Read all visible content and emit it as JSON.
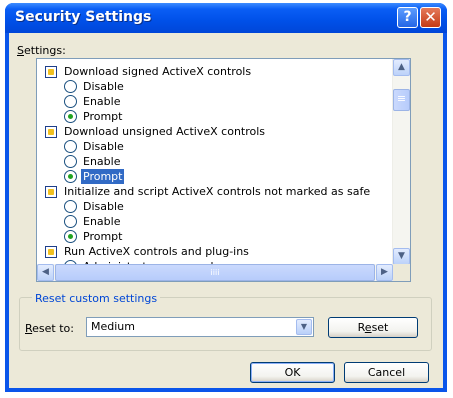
{
  "window": {
    "title": "Security Settings",
    "help_glyph": "?",
    "close_glyph": "✕"
  },
  "settings_label_u": "S",
  "settings_label_rest": "ettings:",
  "tree": {
    "groups": [
      {
        "label": "Download signed ActiveX controls",
        "options": [
          "Disable",
          "Enable",
          "Prompt"
        ],
        "selected": "Prompt"
      },
      {
        "label": "Download unsigned ActiveX controls",
        "options": [
          "Disable",
          "Enable",
          "Prompt"
        ],
        "selected": "Prompt"
      },
      {
        "label": "Initialize and script ActiveX controls not marked as safe",
        "options": [
          "Disable",
          "Enable",
          "Prompt"
        ],
        "selected": "Prompt"
      },
      {
        "label": "Run ActiveX controls and plug-ins",
        "options": [
          "Administrator approved"
        ],
        "selected": null
      }
    ]
  },
  "scroll": {
    "up": "▲",
    "down": "▼",
    "left": "◀",
    "right": "▶",
    "grip": "≡",
    "hgrip": "iiii"
  },
  "reset_group": {
    "legend": "Reset custom settings",
    "reset_to_u": "R",
    "reset_to_rest": "eset to:",
    "selected_value": "Medium",
    "dropdown_glyph": "▼",
    "reset_button_pre": "R",
    "reset_button_u": "e",
    "reset_button_post": "set"
  },
  "buttons": {
    "ok": "OK",
    "cancel": "Cancel"
  }
}
